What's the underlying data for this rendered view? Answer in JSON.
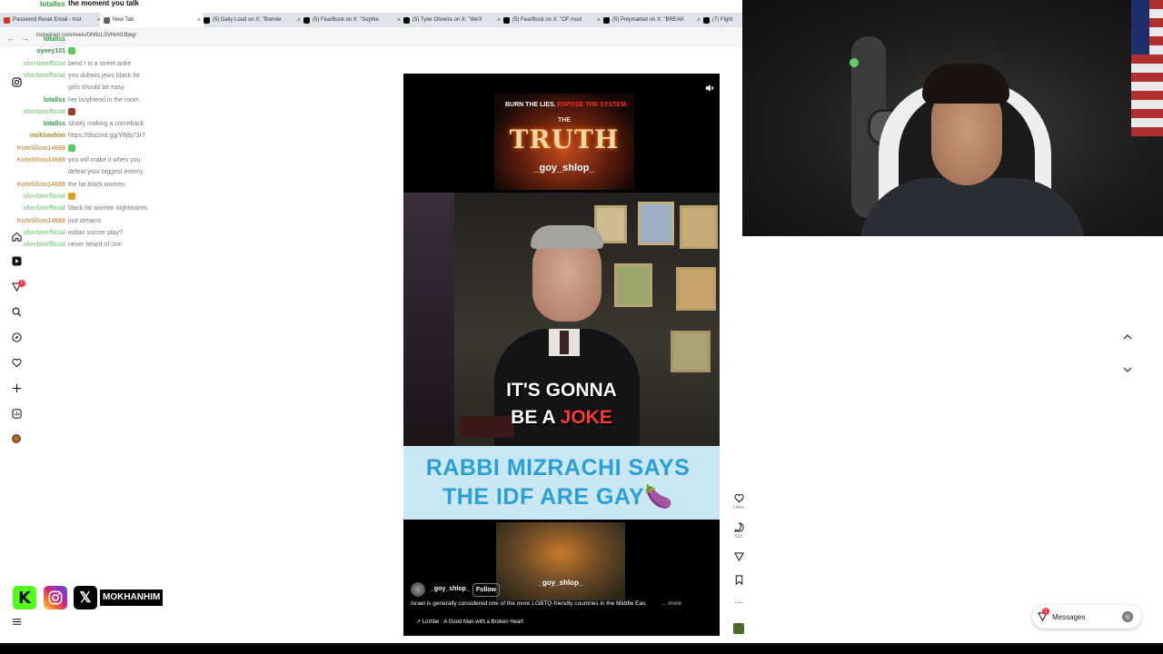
{
  "browser": {
    "tabs": [
      {
        "label": "Password Reset Email - Inst",
        "color": "#d93025"
      },
      {
        "label": "New Tab",
        "color": "#5f6368"
      },
      {
        "label": "(5) Daily Loud on X: \"Bonnie",
        "color": "#000000"
      },
      {
        "label": "(5) FearBuck on X: \"Sophie",
        "color": "#000000"
      },
      {
        "label": "(5) Tyler Oliveira on X: \"We'll",
        "color": "#000000"
      },
      {
        "label": "(5) FearBuck on X: \"OF mod",
        "color": "#000000"
      },
      {
        "label": "(5) Polymarket on X: \"BREAK",
        "color": "#000000"
      },
      {
        "label": "(7) Fight",
        "color": "#000000"
      }
    ],
    "url": "instagram.com/reels/DN9zLSVNmt1Bjeg/"
  },
  "chat": {
    "header_user": "lotallss",
    "header_msg": "the moment you talk",
    "lines": [
      {
        "user": "lotallss",
        "msg": "",
        "color": "#2e9c3f"
      },
      {
        "user": "oyvey101",
        "msg": "",
        "color": "#3a8e4c",
        "emote": "#5cc95a"
      },
      {
        "user": "sherlzeefficial",
        "msg": "bend r is a street anke",
        "color": "#8fce8a"
      },
      {
        "user": "sherlzeefficial",
        "msg": "you dubwis jews black fat",
        "color": "#8fce8a"
      },
      {
        "user": "",
        "msg": "girls should be easy",
        "color": "#8fce8a"
      },
      {
        "user": "lotallss",
        "msg": "her boyfriend in the room",
        "color": "#2e9c3f"
      },
      {
        "user": "sherlzeefficial",
        "msg": "",
        "color": "#8fce8a",
        "emote": "#9a3b2b"
      },
      {
        "user": "lotallss",
        "msg": "slowly making a comeback",
        "color": "#2e9c3f"
      },
      {
        "user": "mokhanhim",
        "msg": "https://discord.gg/Y6jbj73r7",
        "color": "#b08a2b"
      },
      {
        "user": "Kotelillion14688",
        "msg": "",
        "color": "#d29b5c",
        "emote": "#5cc95a"
      },
      {
        "user": "Kotelillion14688",
        "msg": "you will make it when you",
        "color": "#d29b5c"
      },
      {
        "user": "",
        "msg": "defeat your biggest enemy",
        "color": "#d29b5c"
      },
      {
        "user": "Kotelillion14688",
        "msg": "the fat black women",
        "color": "#d29b5c"
      },
      {
        "user": "sherlzeefficial",
        "msg": "",
        "color": "#8fce8a",
        "emote": "#d8a224"
      },
      {
        "user": "sherlzeefficial",
        "msg": "black fat women nightmares",
        "color": "#8fce8a"
      },
      {
        "user": "Kotelillion14688",
        "msg": "just dreams",
        "color": "#d29b5c"
      },
      {
        "user": "sherlzeefficial",
        "msg": "indian soccer play?",
        "color": "#8fce8a"
      },
      {
        "user": "sherlzeefficial",
        "msg": "never heard of one",
        "color": "#8fce8a"
      }
    ]
  },
  "rail": {
    "icons": [
      "instagram-icon",
      "home-icon",
      "reels-icon",
      "notifications-icon",
      "search-icon",
      "explore-icon",
      "heart-icon",
      "create-icon",
      "dashboard-icon",
      "profile-icon"
    ],
    "notification_count": "1"
  },
  "reel": {
    "banner_top": "BURN THE LIES.",
    "banner_top_red": "EXPOSE THE SYSTEM.",
    "banner_the": "THE",
    "banner_title": "TRUTH",
    "banner_handle": "_goy_shlop_",
    "caption_line1": "IT'S GONNA",
    "caption_line2_white": "BE A",
    "caption_line2_red": "JOKE",
    "headline_line1": "RABBI MIZRACHI SAYS",
    "headline_line2": "THE IDF ARE GAY🍆",
    "bottom_handle": "_goy_shlop_",
    "author": "_goy_shlop_",
    "follow_label": "Follow",
    "description": "Israel is generally considered one of the more LGBTQ-friendly countries in the Middle Eas",
    "more_label": "... more",
    "audio": "LoVibe · A Good Man with a Broken Heart"
  },
  "actions": {
    "likes_label": "Likes",
    "comments_count": "523",
    "more_label": "···"
  },
  "socials": {
    "handle": "MOKHANHIM"
  },
  "messages": {
    "label": "Messages",
    "badge": "1"
  },
  "colors": {
    "kick_green": "#53fc18",
    "instagram_gradient": "#d62976",
    "headline_cyan": "#2a9fd8",
    "caption_red": "#ff3b30"
  }
}
